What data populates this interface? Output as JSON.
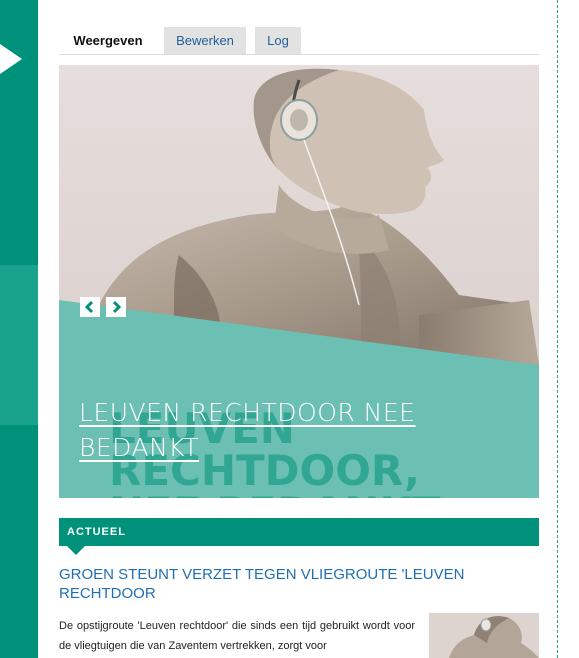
{
  "colors": {
    "brand": "#00917a",
    "brand_light": "#6cc0b3",
    "link": "#1f6fb2"
  },
  "sidebar": {
    "toggle_icon": "triangle-right-icon"
  },
  "tabs": [
    {
      "label": "Weergeven",
      "active": true
    },
    {
      "label": "Bewerken",
      "active": false
    },
    {
      "label": "Log",
      "active": false
    }
  ],
  "hero": {
    "title": "LEUVEN RECHTDOOR NEE BEDANKT",
    "image_text_lines": [
      "LEUVEN",
      "RECHTDOOR,",
      "NEE BEDANKT"
    ],
    "prev_icon": "chevron-left-icon",
    "next_icon": "chevron-right-icon"
  },
  "actueel": {
    "label": "ACTUEEL",
    "items": [
      {
        "title": "GROEN STEUNT VERZET TEGEN VLIEGROUTE 'LEUVEN RECHTDOOR",
        "excerpt": "De opstijgroute 'Leuven rechtdoor' die sinds een tijd gebruikt wordt voor de vliegtuigen die van Zaventem vertrekken, zorgt voor"
      }
    ]
  }
}
